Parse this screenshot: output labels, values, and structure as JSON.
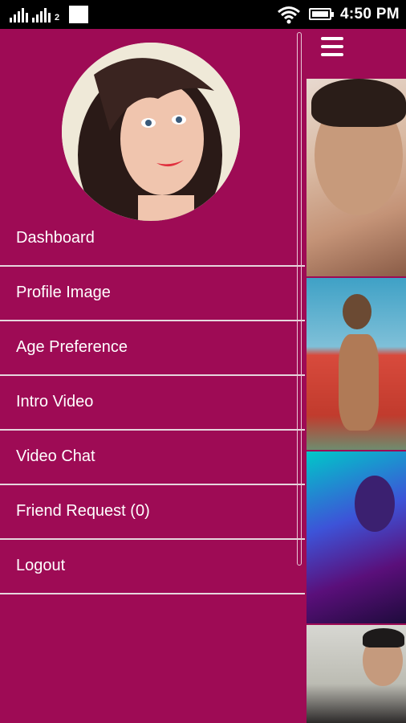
{
  "status_bar": {
    "sim_label": "2",
    "time": "4:50 PM"
  },
  "drawer": {
    "menu": [
      {
        "label": "Dashboard"
      },
      {
        "label": "Profile Image"
      },
      {
        "label": "Age Preference"
      },
      {
        "label": "Intro Video"
      },
      {
        "label": "Video Chat"
      },
      {
        "label": "Friend Request (0)"
      },
      {
        "label": "Logout"
      }
    ]
  },
  "colors": {
    "primary": "#9e0b55",
    "divider": "#e6d6dd",
    "status_bar": "#000000"
  },
  "icons": {
    "menu": "hamburger-icon",
    "wifi": "wifi-icon",
    "battery": "battery-icon",
    "signal": "signal-icon"
  }
}
